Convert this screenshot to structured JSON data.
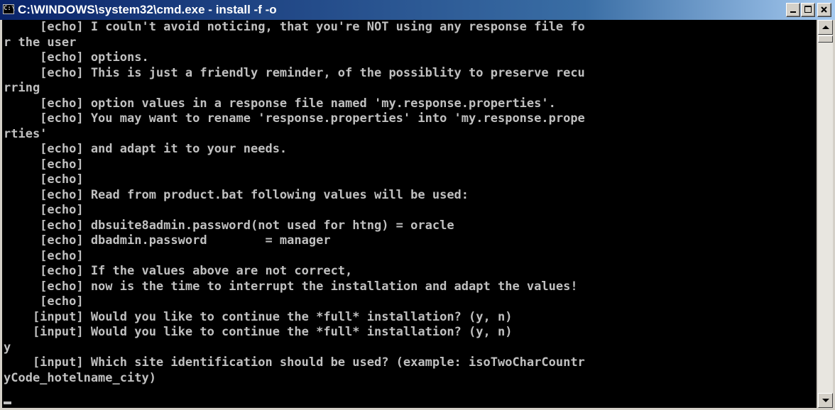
{
  "window": {
    "title": "C:\\WINDOWS\\system32\\cmd.exe - install -f -o",
    "icon": "cmd-icon",
    "icon_text": "C:\\",
    "controls": [
      "minimize-icon",
      "maximize-icon",
      "close-icon"
    ]
  },
  "colors": {
    "titlebar_start": "#0a246a",
    "titlebar_end": "#a6caf0",
    "console_bg": "#000000",
    "console_fg": "#c0c0c0"
  },
  "console": {
    "lines": [
      "     [echo] I couln't avoid noticing, that you're NOT using any response file fo",
      "r the user",
      "     [echo] options.",
      "     [echo] This is just a friendly reminder, of the possiblity to preserve recu",
      "rring",
      "     [echo] option values in a response file named 'my.response.properties'.",
      "     [echo] You may want to rename 'response.properties' into 'my.response.prope",
      "rties'",
      "     [echo] and adapt it to your needs.",
      "     [echo]",
      "     [echo]",
      "     [echo] Read from product.bat following values will be used:",
      "     [echo]",
      "     [echo] dbsuite8admin.password(not used for htng) = oracle",
      "     [echo] dbadmin.password        = manager",
      "     [echo]",
      "     [echo] If the values above are not correct,",
      "     [echo] now is the time to interrupt the installation and adapt the values!",
      "     [echo]",
      "    [input] Would you like to continue the *full* installation? (y, n)",
      "    [input] Would you like to continue the *full* installation? (y, n)",
      "y",
      "    [input] Which site identification should be used? (example: isoTwoCharCountr",
      "yCode_hotelname_city)"
    ]
  }
}
